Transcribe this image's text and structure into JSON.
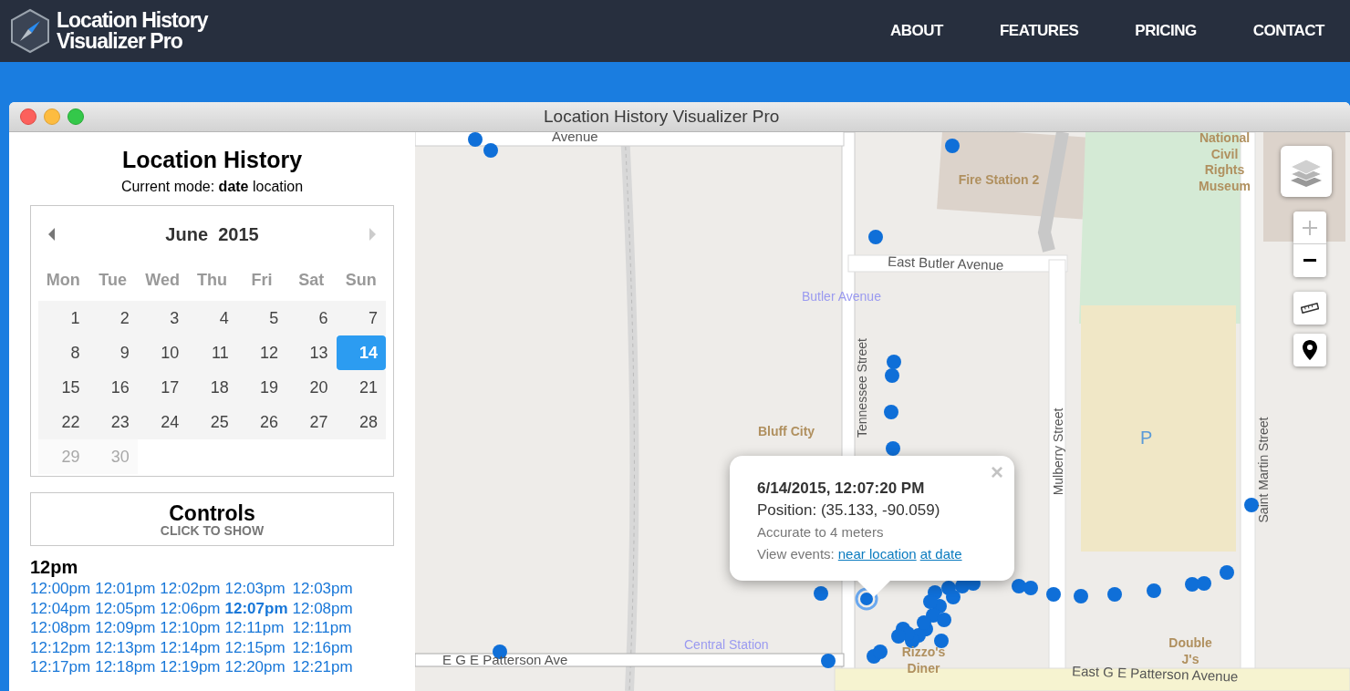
{
  "site": {
    "logo_lines": [
      "Location History",
      "Visualizer Pro"
    ],
    "nav": [
      {
        "label": "ABOUT"
      },
      {
        "label": "FEATURES"
      },
      {
        "label": "PRICING"
      },
      {
        "label": "CONTACT"
      }
    ]
  },
  "window": {
    "title": "Location History Visualizer Pro"
  },
  "sidebar": {
    "title": "Location History",
    "mode": "Current mode: **date** location",
    "calendar": {
      "month": "June  2015",
      "weekdays": [
        "Mon",
        "Tue",
        "Wed",
        "Thu",
        "Fri",
        "Sat",
        "Sun"
      ],
      "days": [
        {
          "label": "1",
          "selected": false,
          "disabled": false
        },
        {
          "label": "2",
          "selected": false,
          "disabled": false
        },
        {
          "label": "3",
          "selected": false,
          "disabled": false
        },
        {
          "label": "4",
          "selected": false,
          "disabled": false
        },
        {
          "label": "5",
          "selected": false,
          "disabled": false
        },
        {
          "label": "6",
          "selected": false,
          "disabled": false
        },
        {
          "label": "7",
          "selected": false,
          "disabled": false
        },
        {
          "label": "8",
          "selected": false,
          "disabled": false
        },
        {
          "label": "9",
          "selected": false,
          "disabled": false
        },
        {
          "label": "10",
          "selected": false,
          "disabled": false
        },
        {
          "label": "11",
          "selected": false,
          "disabled": false
        },
        {
          "label": "12",
          "selected": false,
          "disabled": false
        },
        {
          "label": "13",
          "selected": false,
          "disabled": false
        },
        {
          "label": "14",
          "selected": true,
          "disabled": false
        },
        {
          "label": "15",
          "selected": false,
          "disabled": false
        },
        {
          "label": "16",
          "selected": false,
          "disabled": false
        },
        {
          "label": "17",
          "selected": false,
          "disabled": false
        },
        {
          "label": "18",
          "selected": false,
          "disabled": false
        },
        {
          "label": "19",
          "selected": false,
          "disabled": false
        },
        {
          "label": "20",
          "selected": false,
          "disabled": false
        },
        {
          "label": "21",
          "selected": false,
          "disabled": false
        },
        {
          "label": "22",
          "selected": false,
          "disabled": false
        },
        {
          "label": "23",
          "selected": false,
          "disabled": false
        },
        {
          "label": "24",
          "selected": false,
          "disabled": false
        },
        {
          "label": "25",
          "selected": false,
          "disabled": false
        },
        {
          "label": "26",
          "selected": false,
          "disabled": false
        },
        {
          "label": "27",
          "selected": false,
          "disabled": false
        },
        {
          "label": "28",
          "selected": false,
          "disabled": false
        },
        {
          "label": "29",
          "selected": false,
          "disabled": true
        },
        {
          "label": "30",
          "selected": false,
          "disabled": true
        }
      ]
    },
    "controls": {
      "title": "Controls",
      "hint": "CLICK TO SHOW"
    },
    "hour": "12pm",
    "times": [
      {
        "label": "12:00pm",
        "selected": false
      },
      {
        "label": "12:01pm",
        "selected": false
      },
      {
        "label": "12:02pm",
        "selected": false
      },
      {
        "label": "12:03pm",
        "selected": false
      },
      {
        "label": "12:03pm",
        "selected": false
      },
      {
        "label": "12:04pm",
        "selected": false
      },
      {
        "label": "12:05pm",
        "selected": false
      },
      {
        "label": "12:06pm",
        "selected": false
      },
      {
        "label": "12:07pm",
        "selected": true
      },
      {
        "label": "12:08pm",
        "selected": false
      },
      {
        "label": "12:08pm",
        "selected": false
      },
      {
        "label": "12:09pm",
        "selected": false
      },
      {
        "label": "12:10pm",
        "selected": false
      },
      {
        "label": "12:11pm",
        "selected": false
      },
      {
        "label": "12:11pm",
        "selected": false
      },
      {
        "label": "12:12pm",
        "selected": false
      },
      {
        "label": "12:13pm",
        "selected": false
      },
      {
        "label": "12:14pm",
        "selected": false
      },
      {
        "label": "12:15pm",
        "selected": false
      },
      {
        "label": "12:16pm",
        "selected": false
      },
      {
        "label": "12:17pm",
        "selected": false
      },
      {
        "label": "12:18pm",
        "selected": false
      },
      {
        "label": "12:19pm",
        "selected": false
      },
      {
        "label": "12:20pm",
        "selected": false
      },
      {
        "label": "12:21pm",
        "selected": false
      }
    ]
  },
  "map": {
    "labels": [
      {
        "kind": "street",
        "text": "Avenue"
      },
      {
        "kind": "poi",
        "text": "Fire Station 2"
      },
      {
        "kind": "poi",
        "text": "National Civil Rights Museum"
      },
      {
        "kind": "street",
        "text": "East Butler Avenue"
      },
      {
        "kind": "transit",
        "text": "Butler Avenue"
      },
      {
        "kind": "vstreet",
        "text": "Tennessee Street"
      },
      {
        "kind": "poi",
        "text": "Bluff City"
      },
      {
        "kind": "vstreet",
        "text": "Mulberry Street"
      },
      {
        "kind": "parking",
        "text": "P"
      },
      {
        "kind": "vstreet",
        "text": "Saint Martin Street"
      },
      {
        "kind": "transit",
        "text": "Central Station"
      },
      {
        "kind": "street",
        "text": "E G E Patterson Ave"
      },
      {
        "kind": "poi",
        "text": "Rizzo's Diner"
      },
      {
        "kind": "poi",
        "text": "Double J's"
      },
      {
        "kind": "street",
        "text": "East G E Patterson Avenue"
      }
    ],
    "popup": {
      "title": "6/14/2015, 12:07:20 PM",
      "position": "Position: (35.133, -90.059)",
      "accuracy": "Accurate to 4 meters",
      "events_label": "View events:",
      "links": [
        "near location",
        "at date"
      ],
      "close": "×"
    },
    "zoom_in_disabled": true
  }
}
